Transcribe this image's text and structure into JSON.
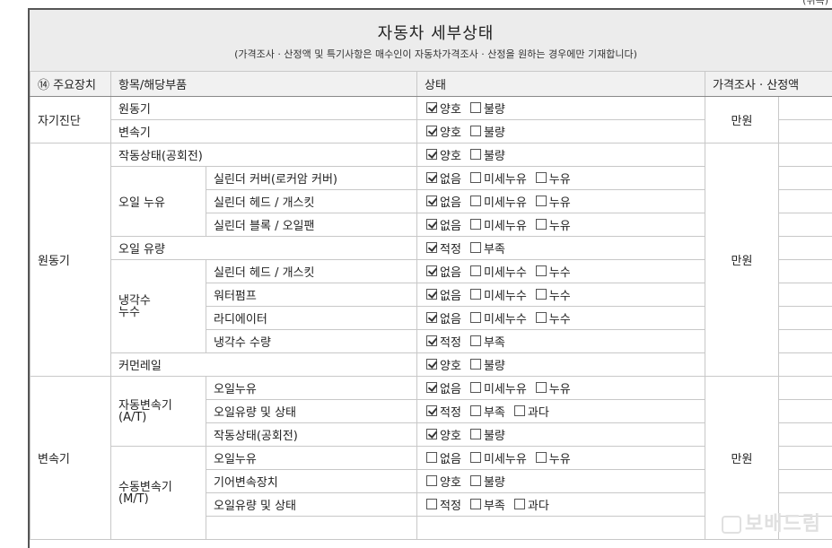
{
  "corner_text": "(뒤쪽)",
  "header": {
    "title": "자동차 세부상태",
    "subtitle": "(가격조사 · 산정액 및 특기사항은 매수인이 자동차가격조사 · 산정을 원하는 경우에만 기재합니다)"
  },
  "columns": {
    "device": "⑭ 주요장치",
    "item": "항목/해당부품",
    "status": "상태",
    "price": "가격조사 · 산정액"
  },
  "unit": "만원",
  "groups": {
    "self_diag": "자기진단",
    "engine": "원동기",
    "transmission": "변속기"
  },
  "rows": {
    "r1": {
      "label": "원동기",
      "opts": [
        {
          "t": "양호",
          "on": true
        },
        {
          "t": "불량",
          "on": false
        }
      ]
    },
    "r2": {
      "label": "변속기",
      "opts": [
        {
          "t": "양호",
          "on": true
        },
        {
          "t": "불량",
          "on": false
        }
      ]
    },
    "r3": {
      "label": "작동상태(공회전)",
      "opts": [
        {
          "t": "양호",
          "on": true
        },
        {
          "t": "불량",
          "on": false
        }
      ]
    },
    "oil_leak": "오일 누유",
    "r4": {
      "label": "실린더 커버(로커암 커버)",
      "opts": [
        {
          "t": "없음",
          "on": true
        },
        {
          "t": "미세누유",
          "on": false
        },
        {
          "t": "누유",
          "on": false
        }
      ]
    },
    "r5": {
      "label": "실린더 헤드 / 개스킷",
      "opts": [
        {
          "t": "없음",
          "on": true
        },
        {
          "t": "미세누유",
          "on": false
        },
        {
          "t": "누유",
          "on": false
        }
      ]
    },
    "r6": {
      "label": "실린더 블록 / 오일팬",
      "opts": [
        {
          "t": "없음",
          "on": true
        },
        {
          "t": "미세누유",
          "on": false
        },
        {
          "t": "누유",
          "on": false
        }
      ]
    },
    "r7": {
      "label": "오일 유량",
      "opts": [
        {
          "t": "적정",
          "on": true
        },
        {
          "t": "부족",
          "on": false
        }
      ]
    },
    "coolant": "냉각수\n누수",
    "r8": {
      "label": "실린더 헤드 / 개스킷",
      "opts": [
        {
          "t": "없음",
          "on": true
        },
        {
          "t": "미세누수",
          "on": false
        },
        {
          "t": "누수",
          "on": false
        }
      ]
    },
    "r9": {
      "label": "워터펌프",
      "opts": [
        {
          "t": "없음",
          "on": true
        },
        {
          "t": "미세누수",
          "on": false
        },
        {
          "t": "누수",
          "on": false
        }
      ]
    },
    "r10": {
      "label": "라디에이터",
      "opts": [
        {
          "t": "없음",
          "on": true
        },
        {
          "t": "미세누수",
          "on": false
        },
        {
          "t": "누수",
          "on": false
        }
      ]
    },
    "r11": {
      "label": "냉각수 수량",
      "opts": [
        {
          "t": "적정",
          "on": true
        },
        {
          "t": "부족",
          "on": false
        }
      ]
    },
    "r12": {
      "label": "커먼레일",
      "opts": [
        {
          "t": "양호",
          "on": true
        },
        {
          "t": "불량",
          "on": false
        }
      ]
    },
    "auto_trans": "자동변속기\n(A/T)",
    "r13": {
      "label": "오일누유",
      "opts": [
        {
          "t": "없음",
          "on": true
        },
        {
          "t": "미세누유",
          "on": false
        },
        {
          "t": "누유",
          "on": false
        }
      ]
    },
    "r14": {
      "label": "오일유량 및 상태",
      "opts": [
        {
          "t": "적정",
          "on": true
        },
        {
          "t": "부족",
          "on": false
        },
        {
          "t": "과다",
          "on": false
        }
      ]
    },
    "r15": {
      "label": "작동상태(공회전)",
      "opts": [
        {
          "t": "양호",
          "on": true
        },
        {
          "t": "불량",
          "on": false
        }
      ]
    },
    "manual_trans": "수동변속기\n(M/T)",
    "r16": {
      "label": "오일누유",
      "opts": [
        {
          "t": "없음",
          "on": false
        },
        {
          "t": "미세누유",
          "on": false
        },
        {
          "t": "누유",
          "on": false
        }
      ]
    },
    "r17": {
      "label": "기어변속장치",
      "opts": [
        {
          "t": "양호",
          "on": false
        },
        {
          "t": "불량",
          "on": false
        }
      ]
    },
    "r18": {
      "label": "오일유량 및 상태",
      "opts": [
        {
          "t": "적정",
          "on": false
        },
        {
          "t": "부족",
          "on": false
        },
        {
          "t": "과다",
          "on": false
        }
      ]
    }
  },
  "watermark": "보배드림"
}
